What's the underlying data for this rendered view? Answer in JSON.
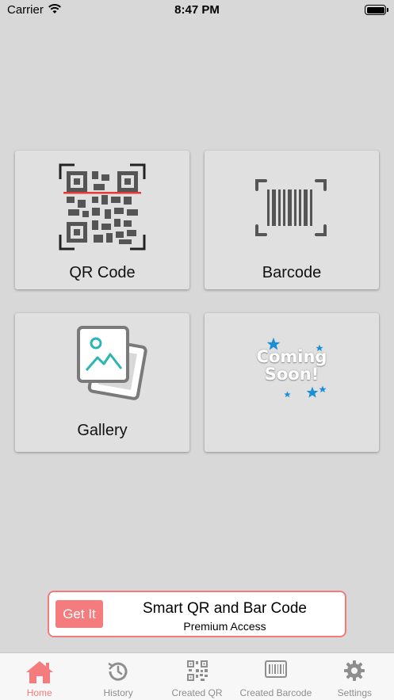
{
  "status_bar": {
    "carrier": "Carrier",
    "time": "8:47 PM"
  },
  "tiles": {
    "qr": {
      "label": "QR Code"
    },
    "barcode": {
      "label": "Barcode"
    },
    "gallery": {
      "label": "Gallery"
    },
    "coming_soon": {
      "text_line1": "Coming",
      "text_line2": "Soon!"
    }
  },
  "banner": {
    "button_label": "Get It",
    "title": "Smart QR and Bar Code",
    "subtitle": "Premium Access"
  },
  "tab_bar": {
    "active": "home",
    "items": [
      {
        "id": "home",
        "label": "Home",
        "icon": "home-icon"
      },
      {
        "id": "history",
        "label": "History",
        "icon": "clock-icon"
      },
      {
        "id": "created_qr",
        "label": "Created QR",
        "icon": "qr-icon"
      },
      {
        "id": "created_barcode",
        "label": "Created Barcode",
        "icon": "barcode-icon"
      },
      {
        "id": "settings",
        "label": "Settings",
        "icon": "gear-icon"
      }
    ]
  },
  "colors": {
    "accent": "#f47c7c",
    "background": "#d8d8d8",
    "tile": "#e0e0e0",
    "icon_gray": "#555555",
    "gallery_teal": "#2bb5b5",
    "star_blue": "#1a8fd6"
  }
}
